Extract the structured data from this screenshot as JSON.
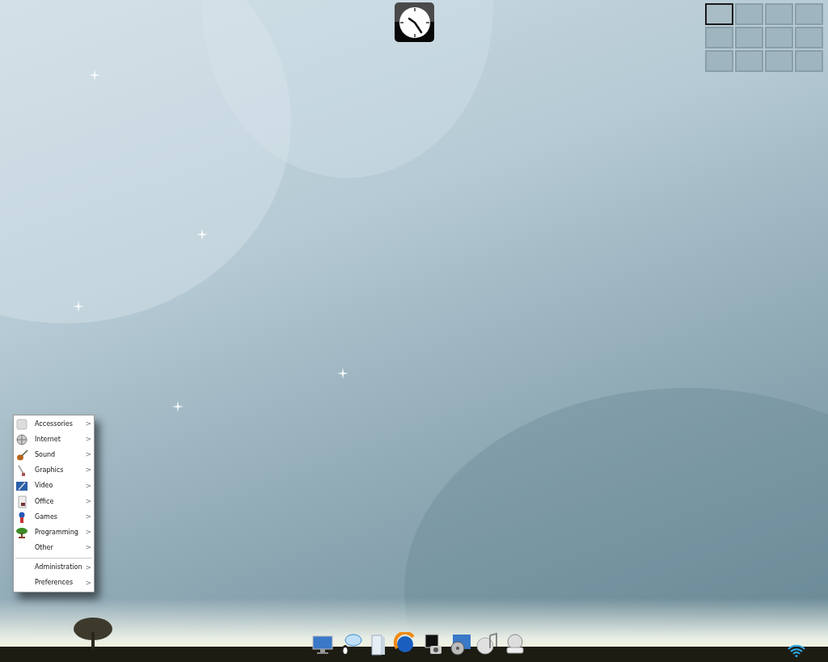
{
  "menu": {
    "items": [
      {
        "kind": "item",
        "label": "Accessories",
        "arrow": ">"
      },
      {
        "kind": "item",
        "label": "Internet",
        "arrow": ">"
      },
      {
        "kind": "item",
        "label": "Sound",
        "arrow": ">"
      },
      {
        "kind": "item",
        "label": "Graphics",
        "arrow": ">"
      },
      {
        "kind": "item",
        "label": "Video",
        "arrow": ">"
      },
      {
        "kind": "item",
        "label": "Office",
        "arrow": ">"
      },
      {
        "kind": "item",
        "label": "Games",
        "arrow": ">"
      },
      {
        "kind": "item",
        "label": "Programming",
        "arrow": ">"
      },
      {
        "kind": "item",
        "label": "Other",
        "arrow": ">"
      },
      {
        "kind": "separator"
      },
      {
        "kind": "item",
        "label": "Administration",
        "arrow": ">"
      },
      {
        "kind": "item",
        "label": "Preferences",
        "arrow": ">"
      }
    ]
  },
  "workspaces": [
    {
      "selected": true
    },
    {
      "selected": false
    },
    {
      "selected": false
    },
    {
      "selected": false
    },
    {
      "selected": false
    },
    {
      "selected": false
    },
    {
      "selected": false
    },
    {
      "selected": false
    },
    {
      "selected": false
    },
    {
      "selected": false
    },
    {
      "selected": false
    },
    {
      "selected": false
    }
  ]
}
